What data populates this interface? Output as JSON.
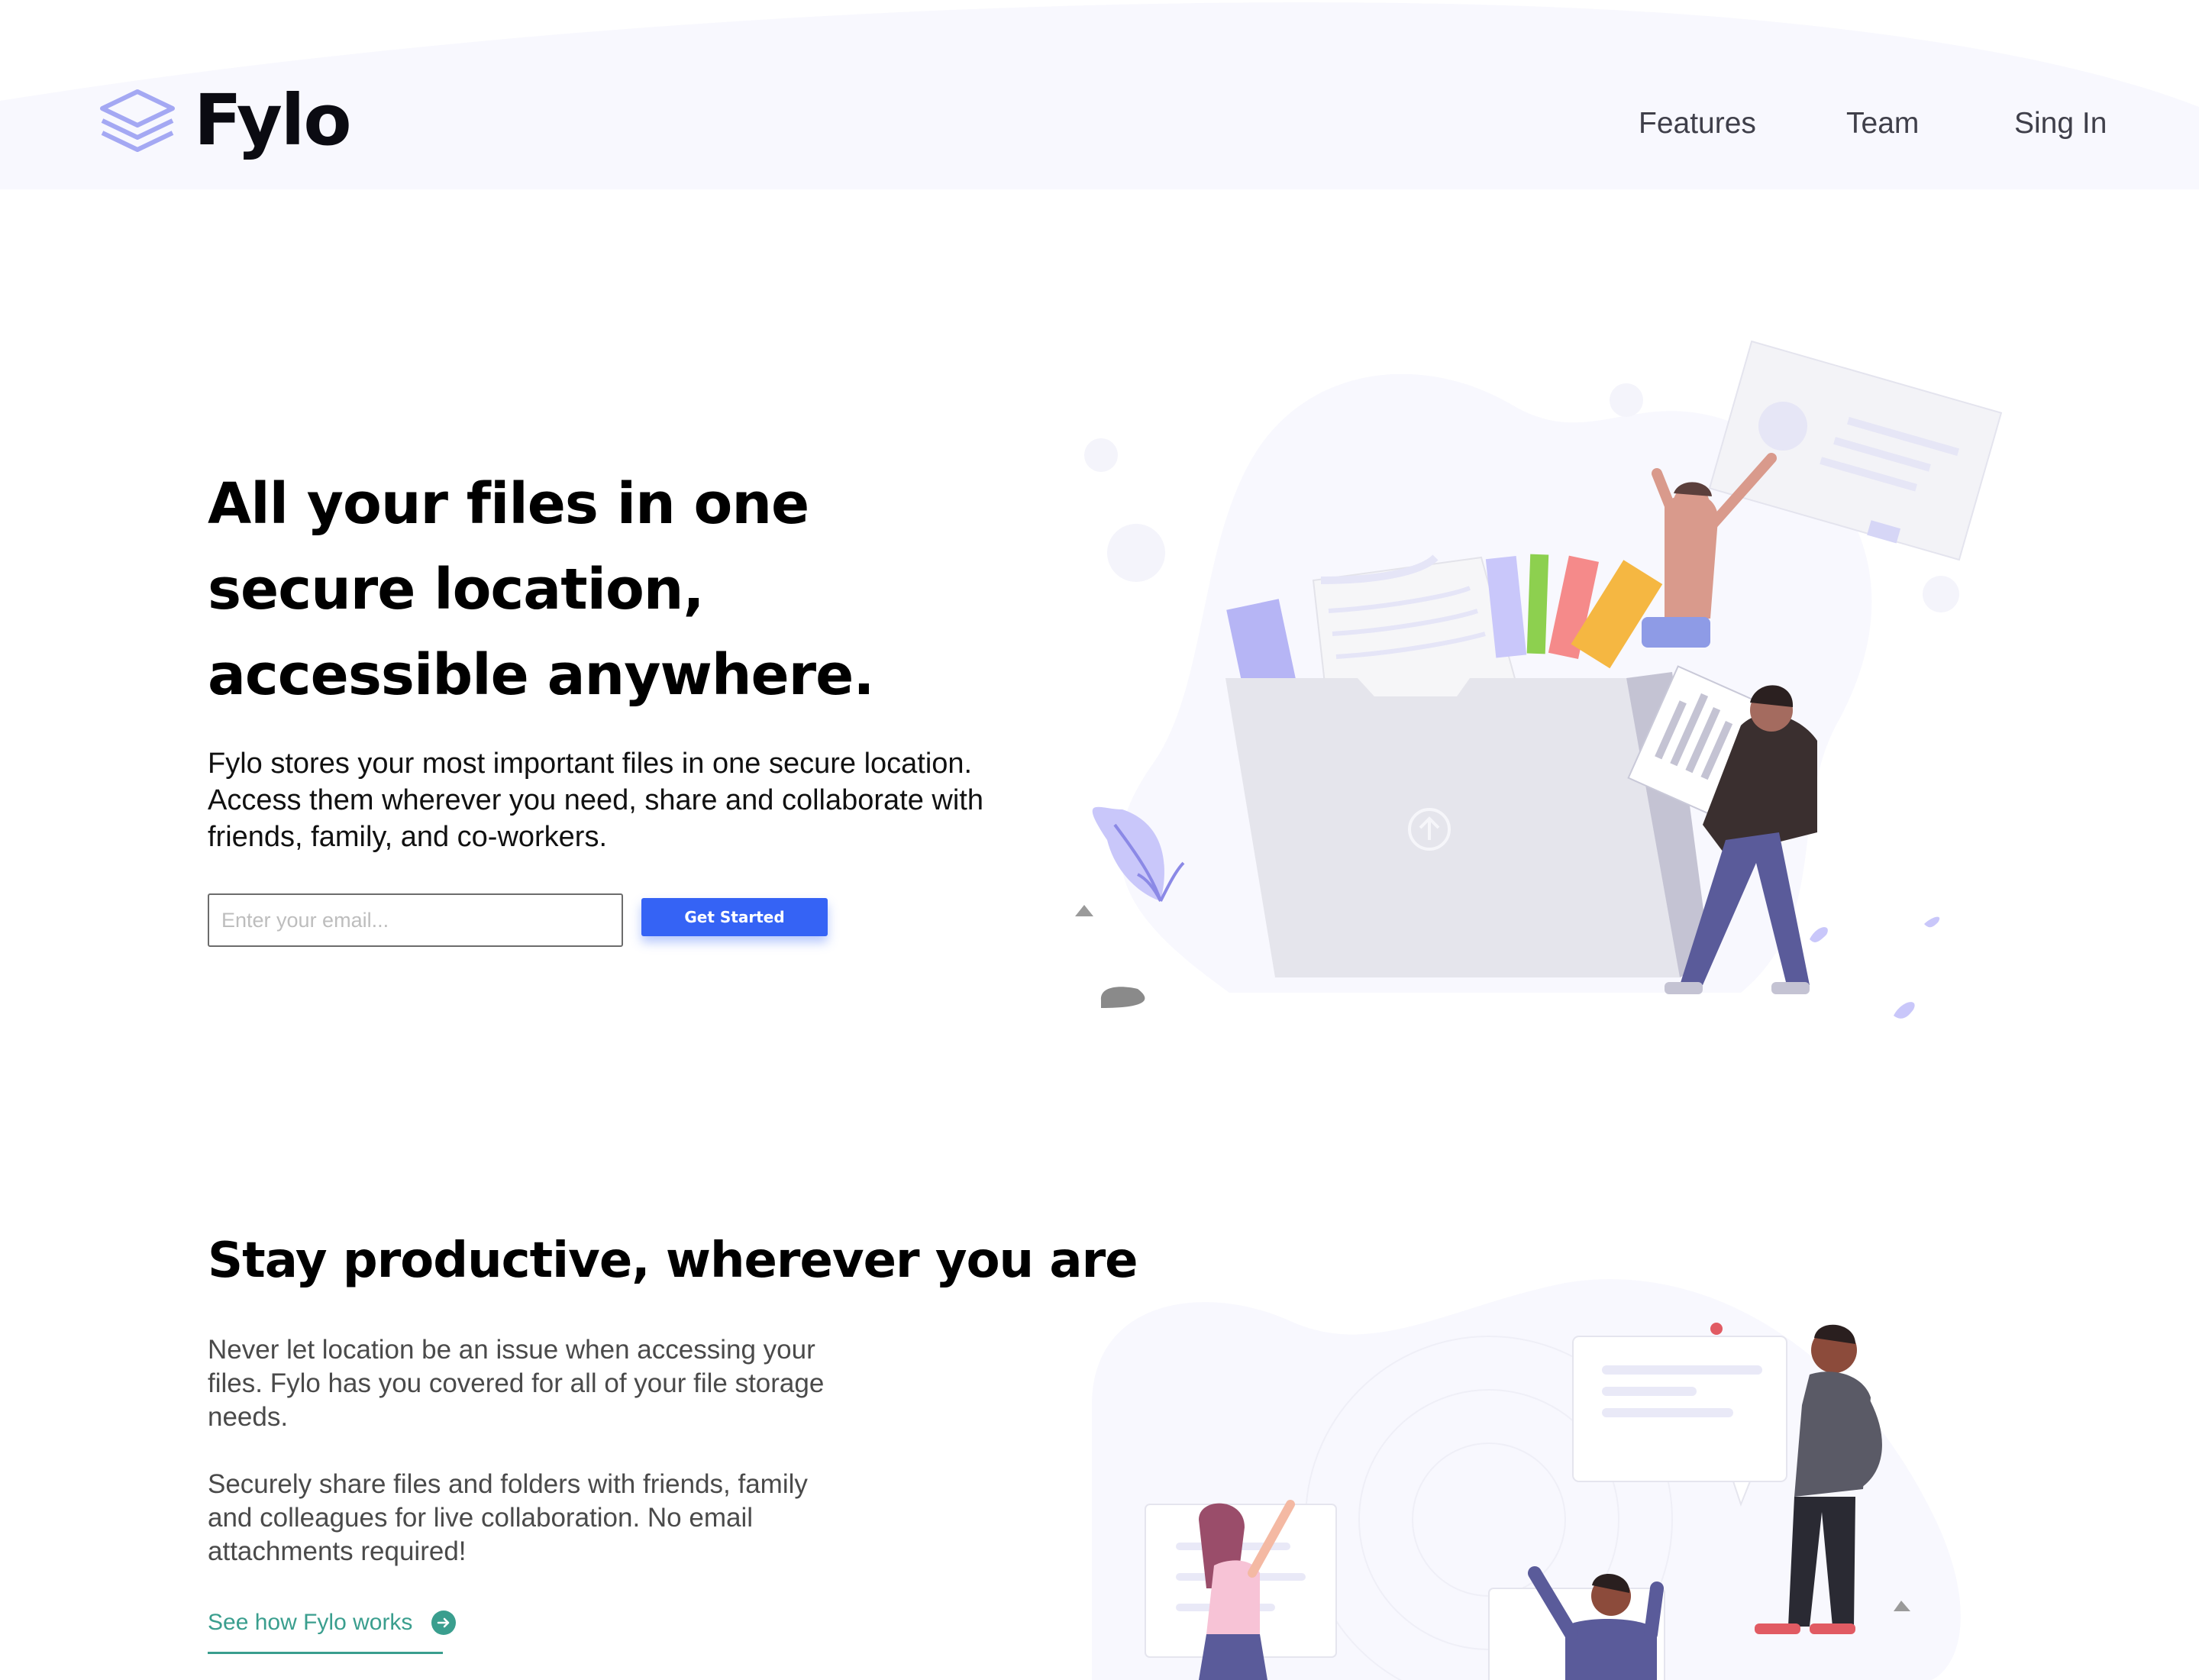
{
  "brand": {
    "name": "Fylo",
    "logo_icon": "stacked-layers-icon",
    "accent": "#a4a8f3"
  },
  "nav": {
    "items": [
      {
        "label": "Features"
      },
      {
        "label": "Team"
      },
      {
        "label": "Sing In"
      }
    ]
  },
  "hero": {
    "title": "All your files in one secure location, accessible anywhere.",
    "text": "Fylo stores your most important files in one secure location. Access them wherever you need, share and collaborate with friends, family, and co-workers.",
    "email_placeholder": "Enter your email...",
    "cta_label": "Get Started",
    "cta_color": "#3563f5"
  },
  "productive": {
    "title": "Stay productive, wherever you are",
    "paragraphs": [
      "Never let location be an issue when accessing your files. Fylo has you covered for all of your file storage needs.",
      "Securely share files and folders with friends, family and colleagues for live collaboration. No email attachments required!"
    ],
    "link_label": "See how Fylo works",
    "link_icon": "arrow-right-circle-icon",
    "link_color": "#3a9e8e"
  }
}
